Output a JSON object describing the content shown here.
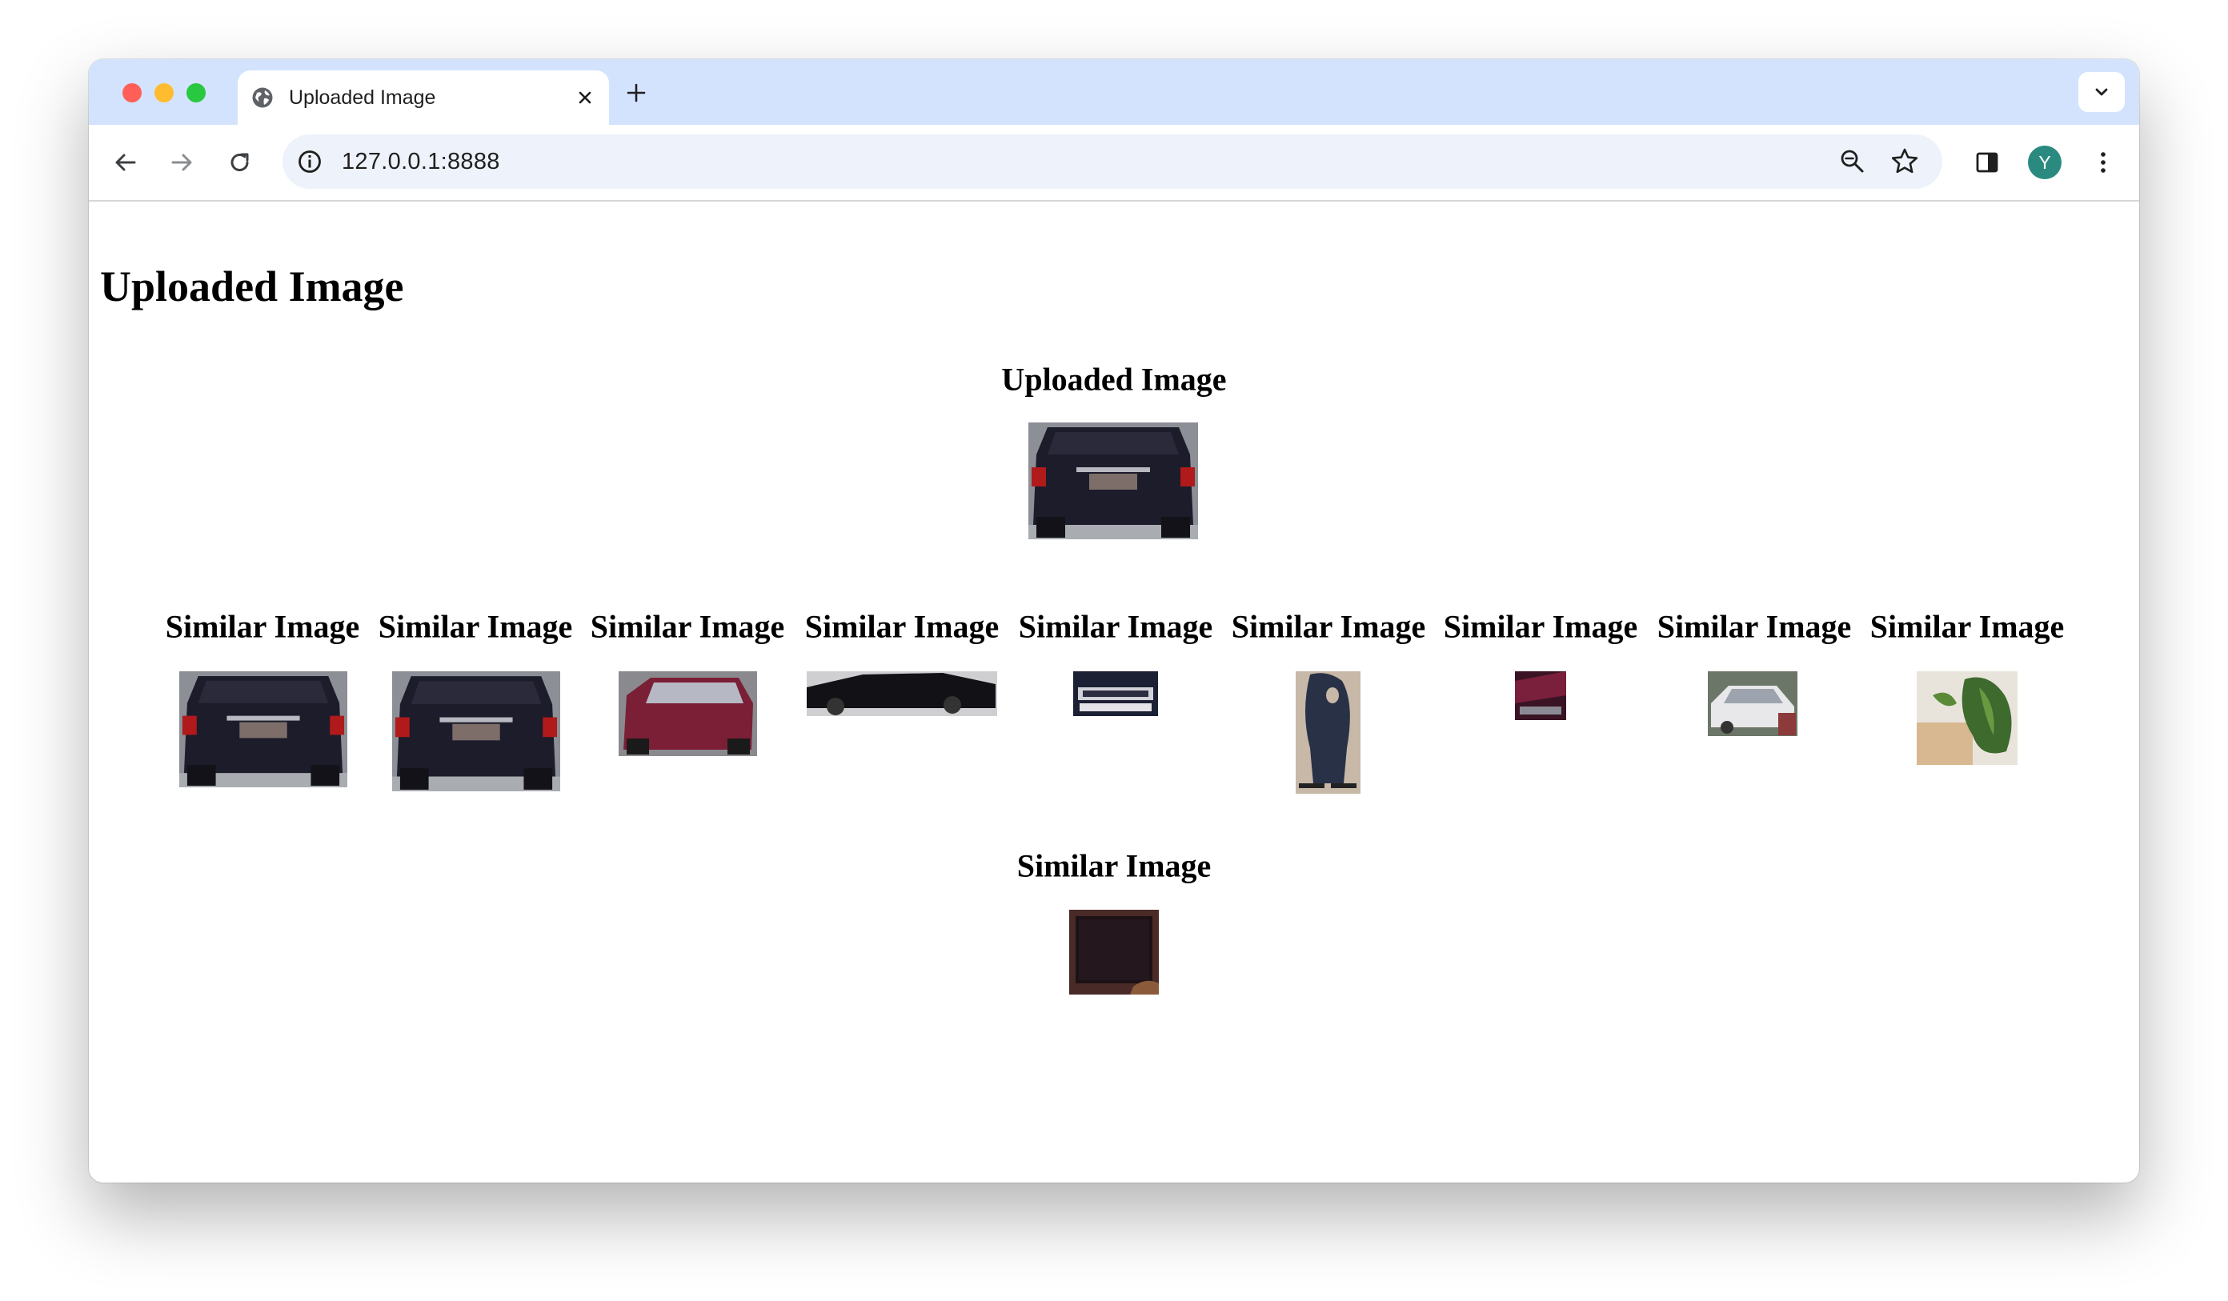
{
  "browser": {
    "tab_title": "Uploaded Image",
    "url": "127.0.0.1:8888",
    "avatar_letter": "Y"
  },
  "icons": {
    "tab": "globe-icon",
    "tab_close": "close-icon",
    "new_tab": "plus-icon",
    "tab_search": "chevron-down-icon",
    "nav_back": "arrow-left-icon",
    "nav_forward": "arrow-right-icon",
    "nav_reload": "reload-icon",
    "site_info": "info-icon",
    "zoom": "zoom-out-icon",
    "bookmark": "star-icon",
    "side_panel": "side-panel-icon",
    "menu": "kebab-menu-icon"
  },
  "colors": {
    "tabstrip_bg": "#d3e3fd",
    "omnibox_bg": "#eef2fa",
    "avatar_bg": "#2b8a80"
  },
  "page": {
    "heading": "Uploaded Image",
    "uploaded": {
      "caption": "Uploaded Image",
      "image": "dark SUV rear view"
    },
    "similar": [
      {
        "caption": "Similar Image",
        "image": "dark SUV rear view"
      },
      {
        "caption": "Similar Image",
        "image": "dark SUV rear view"
      },
      {
        "caption": "Similar Image",
        "image": "red minivan"
      },
      {
        "caption": "Similar Image",
        "image": "black sedan side view"
      },
      {
        "caption": "Similar Image",
        "image": "vehicle front grille"
      },
      {
        "caption": "Similar Image",
        "image": "dark blue chair"
      },
      {
        "caption": "Similar Image",
        "image": "dark red object"
      },
      {
        "caption": "Similar Image",
        "image": "white car"
      },
      {
        "caption": "Similar Image",
        "image": "potted plant"
      },
      {
        "caption": "Similar Image",
        "image": "dark monitor screen"
      }
    ]
  }
}
